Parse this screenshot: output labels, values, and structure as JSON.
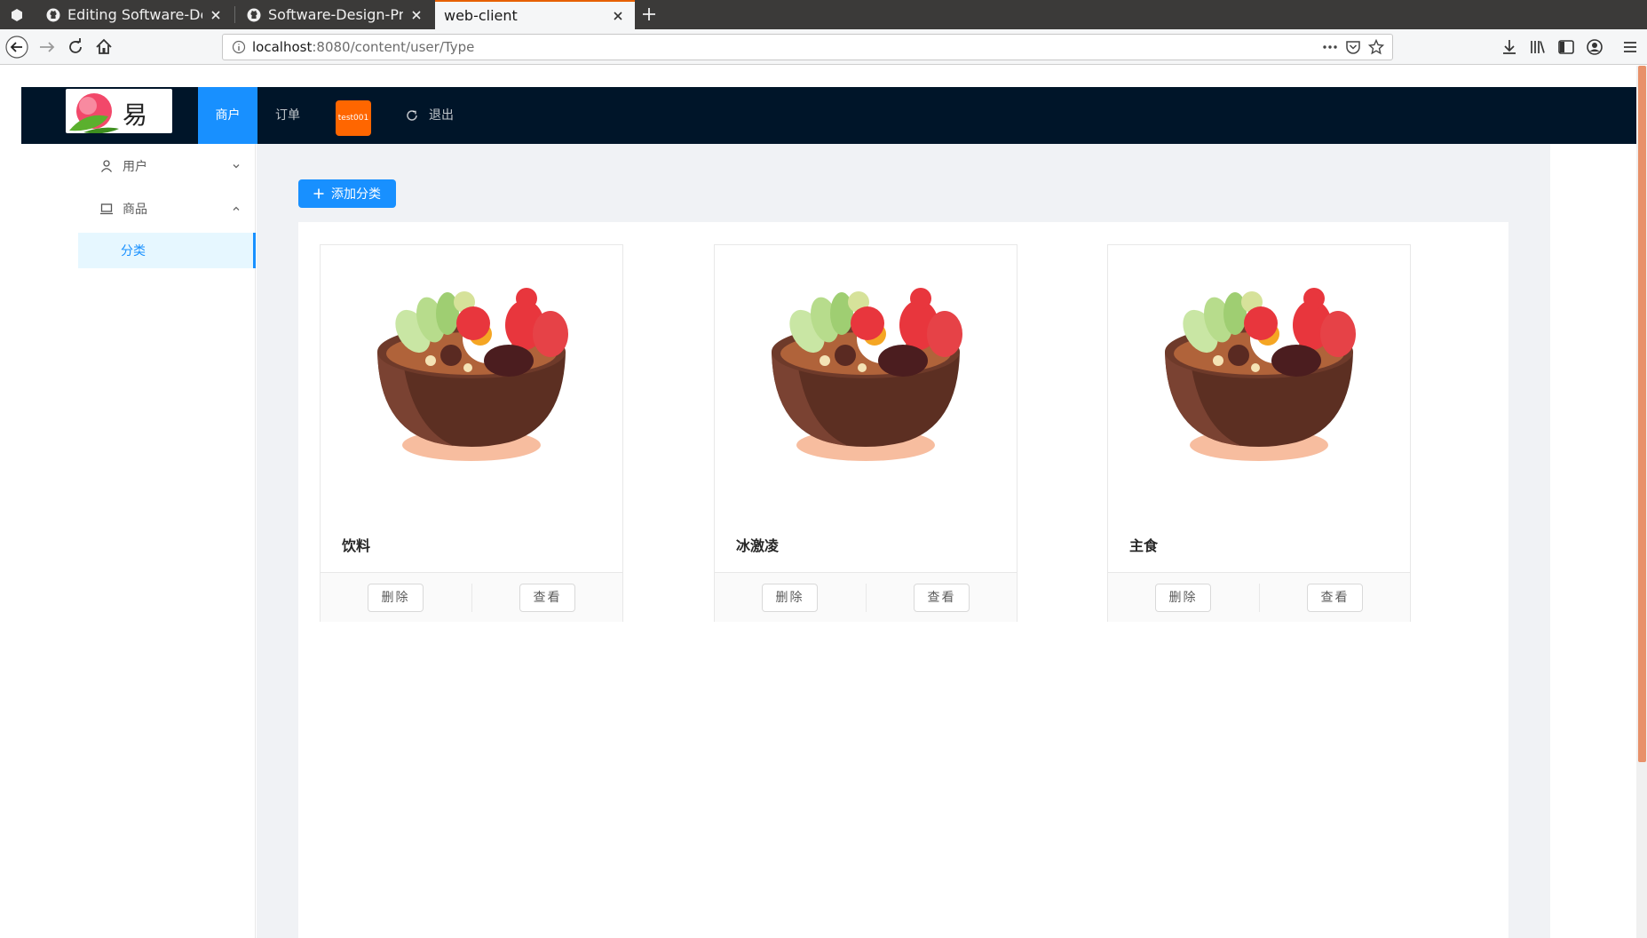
{
  "browser": {
    "tabs": [
      {
        "title": "Editing Software-Design-Project",
        "icon": "github-icon"
      },
      {
        "title": "Software-Design-Project",
        "icon": "github-icon"
      },
      {
        "title": "web-client",
        "icon": ""
      }
    ],
    "url_host": "localhost",
    "url_path": ":8080/content/user/Type",
    "accent": "#e66000"
  },
  "app": {
    "logo_text": "易餐",
    "header_menu": {
      "merchant": "商户",
      "orders": "订单",
      "user_badge": "test001",
      "logout": "退出"
    },
    "sidebar": {
      "user": "用户",
      "goods": "商品",
      "category": "分类"
    },
    "add_button": "添加分类",
    "cards": [
      {
        "title": "饮料",
        "delete": "删除",
        "view": "查看"
      },
      {
        "title": "冰激凌",
        "delete": "删除",
        "view": "查看"
      },
      {
        "title": "主食",
        "delete": "删除",
        "view": "查看"
      }
    ],
    "colors": {
      "header_bg": "#001529",
      "primary": "#1890ff",
      "badge": "#ff6600"
    }
  }
}
